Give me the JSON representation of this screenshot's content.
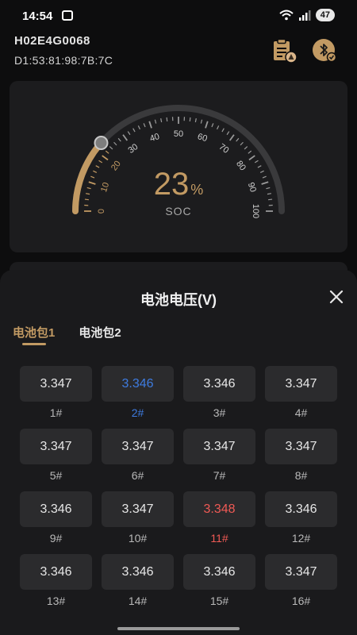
{
  "status_bar": {
    "time": "14:54",
    "battery": "47"
  },
  "device": {
    "id": "H02E4G0068",
    "mac": "D1:53:81:98:7B:7C"
  },
  "gauge": {
    "value": 23,
    "value_text": "23",
    "unit": "%",
    "label": "SOC",
    "ticks": [
      "0",
      "10",
      "20",
      "30",
      "40",
      "50",
      "60",
      "70",
      "80",
      "90",
      "100"
    ],
    "accent_color": "#c29a63"
  },
  "sheet": {
    "title": "电池电压(V)",
    "tabs": [
      {
        "label": "电池包1",
        "active": true
      },
      {
        "label": "电池包2",
        "active": false
      }
    ],
    "cells": [
      {
        "value": "3.347",
        "label": "1#",
        "state": "normal"
      },
      {
        "value": "3.346",
        "label": "2#",
        "state": "low"
      },
      {
        "value": "3.346",
        "label": "3#",
        "state": "normal"
      },
      {
        "value": "3.347",
        "label": "4#",
        "state": "normal"
      },
      {
        "value": "3.347",
        "label": "5#",
        "state": "normal"
      },
      {
        "value": "3.347",
        "label": "6#",
        "state": "normal"
      },
      {
        "value": "3.347",
        "label": "7#",
        "state": "normal"
      },
      {
        "value": "3.347",
        "label": "8#",
        "state": "normal"
      },
      {
        "value": "3.346",
        "label": "9#",
        "state": "normal"
      },
      {
        "value": "3.347",
        "label": "10#",
        "state": "normal"
      },
      {
        "value": "3.348",
        "label": "11#",
        "state": "high"
      },
      {
        "value": "3.346",
        "label": "12#",
        "state": "normal"
      },
      {
        "value": "3.346",
        "label": "13#",
        "state": "normal"
      },
      {
        "value": "3.346",
        "label": "14#",
        "state": "normal"
      },
      {
        "value": "3.346",
        "label": "15#",
        "state": "normal"
      },
      {
        "value": "3.347",
        "label": "16#",
        "state": "normal"
      }
    ],
    "colors": {
      "low": "#3e7be0",
      "high": "#f05a55"
    }
  },
  "icons": {
    "report": "report-icon",
    "bluetooth": "bluetooth-icon",
    "close": "close-icon",
    "wifi": "wifi-icon",
    "signal": "signal-icon",
    "scan": "screen-scan-icon"
  }
}
